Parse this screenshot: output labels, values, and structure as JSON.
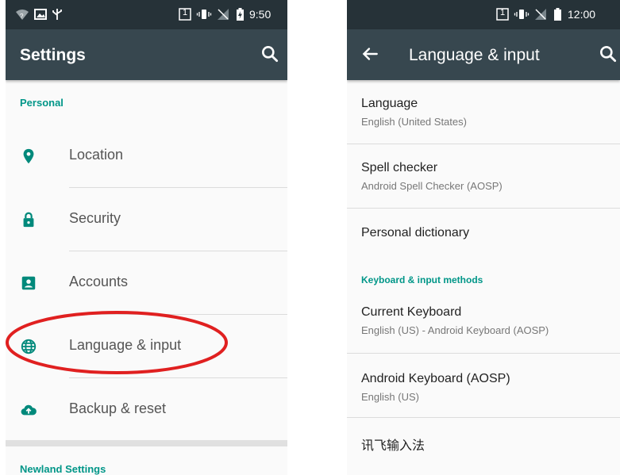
{
  "left": {
    "status_time": "9:50",
    "sim_slot": "1",
    "title": "Settings",
    "category_personal": "Personal",
    "items": [
      {
        "label": "Location",
        "icon": "location-pin-icon"
      },
      {
        "label": "Security",
        "icon": "lock-icon"
      },
      {
        "label": "Accounts",
        "icon": "account-box-icon"
      },
      {
        "label": "Language & input",
        "icon": "globe-icon"
      },
      {
        "label": "Backup & reset",
        "icon": "cloud-upload-icon"
      }
    ],
    "category_newland": "Newland Settings"
  },
  "right": {
    "status_time": "12:00",
    "sim_slot": "1",
    "title": "Language & input",
    "items": [
      {
        "title": "Language",
        "summary": "English (United States)"
      },
      {
        "title": "Spell checker",
        "summary": "Android Spell Checker (AOSP)"
      },
      {
        "title": "Personal dictionary"
      }
    ],
    "category_keyboard": "Keyboard & input methods",
    "keyboard_items": [
      {
        "title": "Current Keyboard",
        "summary": "English (US) - Android Keyboard (AOSP)"
      },
      {
        "title": "Android Keyboard (AOSP)",
        "summary": "English (US)"
      },
      {
        "title": "讯飞输入法"
      }
    ]
  },
  "colors": {
    "status_bar": "#263238",
    "app_bar": "#37474f",
    "accent": "#009688",
    "highlight_ellipse": "#e02020"
  }
}
